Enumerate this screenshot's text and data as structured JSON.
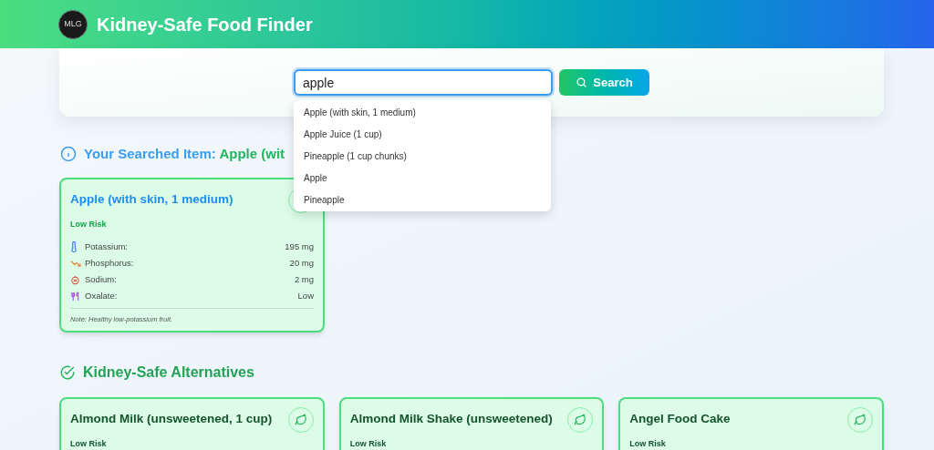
{
  "header": {
    "logo_text": "MLG",
    "title": "Kidney-Safe Food Finder"
  },
  "search": {
    "value": "apple",
    "button": "Search",
    "suggestions": [
      "Apple (with skin, 1 medium)",
      "Apple Juice (1 cup)",
      "Pineapple (1 cup chunks)",
      "Apple",
      "Pineapple"
    ]
  },
  "searched": {
    "heading": "Your Searched Item:",
    "item": "Apple (wit",
    "card": {
      "name": "Apple (with skin, 1 medium)",
      "risk": "Low Risk",
      "nutrients": [
        {
          "label": "Potassium:",
          "value": "195 mg"
        },
        {
          "label": "Phosphorus:",
          "value": "20 mg"
        },
        {
          "label": "Sodium:",
          "value": "2 mg"
        },
        {
          "label": "Oxalate:",
          "value": "Low"
        }
      ],
      "note": "Note: Healthy low-potassium fruit."
    }
  },
  "alternatives": {
    "heading": "Kidney-Safe Alternatives",
    "cards": [
      {
        "name": "Almond Milk (unsweetened, 1 cup)",
        "risk": "Low Risk"
      },
      {
        "name": "Almond Milk Shake (unsweetened)",
        "risk": "Low Risk"
      },
      {
        "name": "Angel Food Cake",
        "risk": "Low Risk"
      }
    ]
  }
}
